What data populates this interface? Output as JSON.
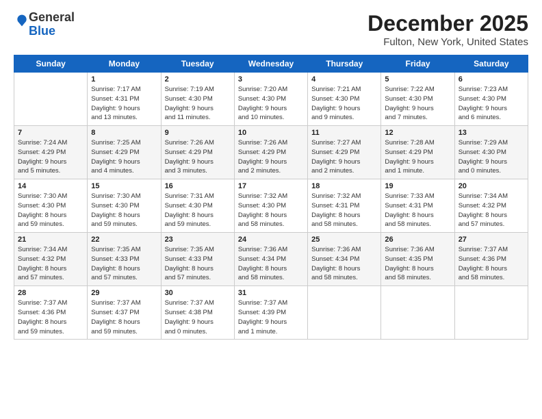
{
  "logo": {
    "general": "General",
    "blue": "Blue"
  },
  "title": "December 2025",
  "subtitle": "Fulton, New York, United States",
  "weekdays": [
    "Sunday",
    "Monday",
    "Tuesday",
    "Wednesday",
    "Thursday",
    "Friday",
    "Saturday"
  ],
  "weeks": [
    [
      {
        "day": "",
        "info": ""
      },
      {
        "day": "1",
        "info": "Sunrise: 7:17 AM\nSunset: 4:31 PM\nDaylight: 9 hours\nand 13 minutes."
      },
      {
        "day": "2",
        "info": "Sunrise: 7:19 AM\nSunset: 4:30 PM\nDaylight: 9 hours\nand 11 minutes."
      },
      {
        "day": "3",
        "info": "Sunrise: 7:20 AM\nSunset: 4:30 PM\nDaylight: 9 hours\nand 10 minutes."
      },
      {
        "day": "4",
        "info": "Sunrise: 7:21 AM\nSunset: 4:30 PM\nDaylight: 9 hours\nand 9 minutes."
      },
      {
        "day": "5",
        "info": "Sunrise: 7:22 AM\nSunset: 4:30 PM\nDaylight: 9 hours\nand 7 minutes."
      },
      {
        "day": "6",
        "info": "Sunrise: 7:23 AM\nSunset: 4:30 PM\nDaylight: 9 hours\nand 6 minutes."
      }
    ],
    [
      {
        "day": "7",
        "info": "Sunrise: 7:24 AM\nSunset: 4:29 PM\nDaylight: 9 hours\nand 5 minutes."
      },
      {
        "day": "8",
        "info": "Sunrise: 7:25 AM\nSunset: 4:29 PM\nDaylight: 9 hours\nand 4 minutes."
      },
      {
        "day": "9",
        "info": "Sunrise: 7:26 AM\nSunset: 4:29 PM\nDaylight: 9 hours\nand 3 minutes."
      },
      {
        "day": "10",
        "info": "Sunrise: 7:26 AM\nSunset: 4:29 PM\nDaylight: 9 hours\nand 2 minutes."
      },
      {
        "day": "11",
        "info": "Sunrise: 7:27 AM\nSunset: 4:29 PM\nDaylight: 9 hours\nand 2 minutes."
      },
      {
        "day": "12",
        "info": "Sunrise: 7:28 AM\nSunset: 4:29 PM\nDaylight: 9 hours\nand 1 minute."
      },
      {
        "day": "13",
        "info": "Sunrise: 7:29 AM\nSunset: 4:30 PM\nDaylight: 9 hours\nand 0 minutes."
      }
    ],
    [
      {
        "day": "14",
        "info": "Sunrise: 7:30 AM\nSunset: 4:30 PM\nDaylight: 8 hours\nand 59 minutes."
      },
      {
        "day": "15",
        "info": "Sunrise: 7:30 AM\nSunset: 4:30 PM\nDaylight: 8 hours\nand 59 minutes."
      },
      {
        "day": "16",
        "info": "Sunrise: 7:31 AM\nSunset: 4:30 PM\nDaylight: 8 hours\nand 59 minutes."
      },
      {
        "day": "17",
        "info": "Sunrise: 7:32 AM\nSunset: 4:30 PM\nDaylight: 8 hours\nand 58 minutes."
      },
      {
        "day": "18",
        "info": "Sunrise: 7:32 AM\nSunset: 4:31 PM\nDaylight: 8 hours\nand 58 minutes."
      },
      {
        "day": "19",
        "info": "Sunrise: 7:33 AM\nSunset: 4:31 PM\nDaylight: 8 hours\nand 58 minutes."
      },
      {
        "day": "20",
        "info": "Sunrise: 7:34 AM\nSunset: 4:32 PM\nDaylight: 8 hours\nand 57 minutes."
      }
    ],
    [
      {
        "day": "21",
        "info": "Sunrise: 7:34 AM\nSunset: 4:32 PM\nDaylight: 8 hours\nand 57 minutes."
      },
      {
        "day": "22",
        "info": "Sunrise: 7:35 AM\nSunset: 4:33 PM\nDaylight: 8 hours\nand 57 minutes."
      },
      {
        "day": "23",
        "info": "Sunrise: 7:35 AM\nSunset: 4:33 PM\nDaylight: 8 hours\nand 57 minutes."
      },
      {
        "day": "24",
        "info": "Sunrise: 7:36 AM\nSunset: 4:34 PM\nDaylight: 8 hours\nand 58 minutes."
      },
      {
        "day": "25",
        "info": "Sunrise: 7:36 AM\nSunset: 4:34 PM\nDaylight: 8 hours\nand 58 minutes."
      },
      {
        "day": "26",
        "info": "Sunrise: 7:36 AM\nSunset: 4:35 PM\nDaylight: 8 hours\nand 58 minutes."
      },
      {
        "day": "27",
        "info": "Sunrise: 7:37 AM\nSunset: 4:36 PM\nDaylight: 8 hours\nand 58 minutes."
      }
    ],
    [
      {
        "day": "28",
        "info": "Sunrise: 7:37 AM\nSunset: 4:36 PM\nDaylight: 8 hours\nand 59 minutes."
      },
      {
        "day": "29",
        "info": "Sunrise: 7:37 AM\nSunset: 4:37 PM\nDaylight: 8 hours\nand 59 minutes."
      },
      {
        "day": "30",
        "info": "Sunrise: 7:37 AM\nSunset: 4:38 PM\nDaylight: 9 hours\nand 0 minutes."
      },
      {
        "day": "31",
        "info": "Sunrise: 7:37 AM\nSunset: 4:39 PM\nDaylight: 9 hours\nand 1 minute."
      },
      {
        "day": "",
        "info": ""
      },
      {
        "day": "",
        "info": ""
      },
      {
        "day": "",
        "info": ""
      }
    ]
  ]
}
